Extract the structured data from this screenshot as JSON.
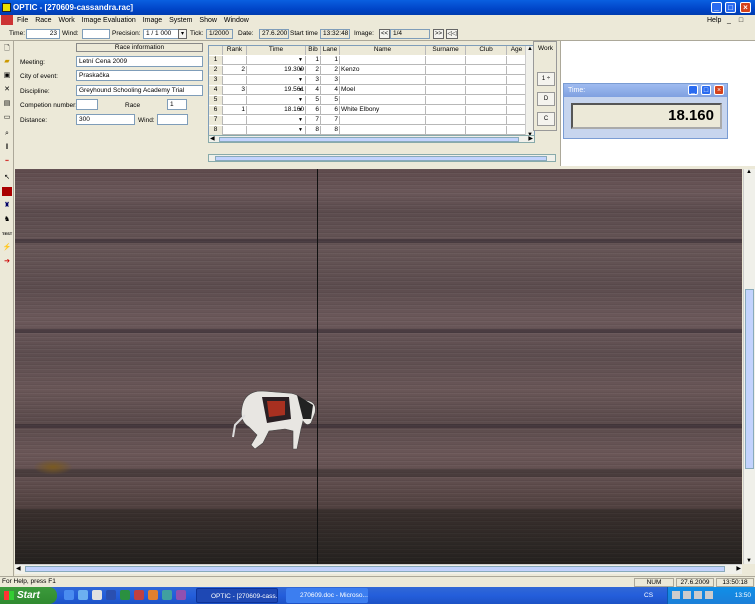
{
  "window": {
    "title": "OPTIC - [270609-cassandra.rac]"
  },
  "menu": [
    "File",
    "Race",
    "Work",
    "Image Evaluation",
    "Image",
    "System",
    "Show",
    "Window"
  ],
  "menu_help": "Help",
  "toolbar2": {
    "time_label": "Time:",
    "time_value": "23",
    "wind_label": "Wind:",
    "wind_value": "",
    "precision_label": "Precision:",
    "precision_value": "1 / 1 000",
    "tick_label": "Tick:",
    "tick_value": "1/2000",
    "date_label": "Date:",
    "date_value": "27.6.200",
    "start_label": "Start time",
    "start_value": "13:32:48",
    "image_label": "Image:",
    "image_prev": "<<",
    "image_value": "1/4",
    "image_next": ">>",
    "image_extra": "◁◁"
  },
  "race_info": {
    "header": "Race information",
    "meeting_label": "Meeting:",
    "meeting_value": "Letní Cena 2009",
    "city_label": "City of event:",
    "city_value": "Praskačka",
    "discipline_label": "Discipline:",
    "discipline_value": "Greyhound Schooling Academy Trial",
    "competition_label": "Competion number:",
    "competition_value": "",
    "race_label": "Race",
    "race_value": "1",
    "distance_label": "Distance:",
    "distance_value": "300",
    "wind_label": "Wind:",
    "wind_value": ""
  },
  "grid": {
    "headers": [
      "",
      "Rank",
      "Time",
      "Bib",
      "Lane",
      "Name",
      "Surname",
      "Club",
      "Age"
    ],
    "rows": [
      {
        "n": "1",
        "rank": "",
        "time": "",
        "bib": "1",
        "lane": "1",
        "name": ""
      },
      {
        "n": "2",
        "rank": "2",
        "time": "19.309",
        "bib": "2",
        "lane": "2",
        "name": "Kenzo"
      },
      {
        "n": "3",
        "rank": "",
        "time": "",
        "bib": "3",
        "lane": "3",
        "name": ""
      },
      {
        "n": "4",
        "rank": "3",
        "time": "19.561",
        "bib": "4",
        "lane": "4",
        "name": "Moel"
      },
      {
        "n": "5",
        "rank": "",
        "time": "",
        "bib": "5",
        "lane": "5",
        "name": ""
      },
      {
        "n": "6",
        "rank": "1",
        "time": "18.160",
        "bib": "6",
        "lane": "6",
        "name": "White Elbony"
      },
      {
        "n": "7",
        "rank": "",
        "time": "",
        "bib": "7",
        "lane": "7",
        "name": ""
      },
      {
        "n": "8",
        "rank": "",
        "time": "",
        "bib": "8",
        "lane": "8",
        "name": ""
      }
    ]
  },
  "work_panel": {
    "label": "Work",
    "btn1": "1 ÷",
    "btn2": "D",
    "btn3": "C"
  },
  "time_window": {
    "title": "Time:",
    "value": "18.160"
  },
  "status": {
    "hint": "For Help, press F1",
    "num": "NUM",
    "date": "27.6.2009",
    "time": "13:50:18"
  },
  "taskbar": {
    "start": "Start",
    "tasks": [
      "OPTIC - [270609-cass...",
      "270609.doc - Microso..."
    ],
    "lang": "CS",
    "clock": "13:50"
  }
}
